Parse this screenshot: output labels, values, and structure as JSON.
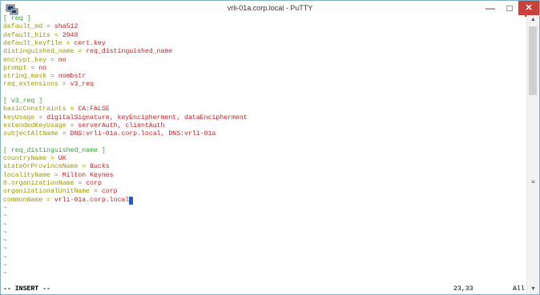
{
  "window": {
    "title": "vrli-01a.corp.local - PuTTY",
    "minimize_glyph": "—",
    "maximize_glyph": "□",
    "close_glyph": "✕"
  },
  "icons": {
    "app": "putty-app-icon",
    "scroll_up": "scroll-up-arrow-icon",
    "scroll_down": "scroll-down-arrow-icon",
    "scroll_grip": "scroll-grip-icon"
  },
  "colors": {
    "key_text": "#9a9a00",
    "value_text": "#cc1f1f",
    "section_text": "#2fa82f",
    "tilde_text": "#3b63d8",
    "cursor": "#1e5bd8",
    "close_button": "#c8403b"
  },
  "editor": {
    "lines": [
      {
        "key": "[ req ]",
        "val": "",
        "type": "section"
      },
      {
        "key": "default_md",
        "val": "sha512",
        "type": "kv"
      },
      {
        "key": "default_bits",
        "val": "2048",
        "type": "kv"
      },
      {
        "key": "default_keyfile",
        "val": "cert.key",
        "type": "kv"
      },
      {
        "key": "distinguished_name",
        "val": "req_distinguished_name",
        "type": "kv"
      },
      {
        "key": "encrypt_key",
        "val": "no",
        "type": "kv"
      },
      {
        "key": "prompt",
        "val": "no",
        "type": "kv"
      },
      {
        "key": "string_mask",
        "val": "nombstr",
        "type": "kv"
      },
      {
        "key": "req_extensions",
        "val": "v3_req",
        "type": "kv"
      },
      {
        "key": "",
        "val": "",
        "type": "blank"
      },
      {
        "key": "[ v3_req ]",
        "val": "",
        "type": "section"
      },
      {
        "key": "basicConstraints",
        "val": "CA:FALSE",
        "type": "kv"
      },
      {
        "key": "keyUsage",
        "val": "digitalSignature, keyEncipherment, dataEncipherment",
        "type": "kv"
      },
      {
        "key": "extendedKeyUsage",
        "val": "serverAuth, clientAuth",
        "type": "kv"
      },
      {
        "key": "subjectAltName",
        "val": "DNS:vrli-01a.corp.local, DNS:vrli-01a",
        "type": "kv"
      },
      {
        "key": "",
        "val": "",
        "type": "blank"
      },
      {
        "key": "[ req_distinguished_name ]",
        "val": "",
        "type": "section"
      },
      {
        "key": "countryName",
        "val": "UK",
        "type": "kv"
      },
      {
        "key": "stateOrProvinceName",
        "val": "Bucks",
        "type": "kv"
      },
      {
        "key": "localityName",
        "val": "Milton Keynes",
        "type": "kv"
      },
      {
        "key": "0.organizationName",
        "val": "corp",
        "type": "kv"
      },
      {
        "key": "organizationalUnitName",
        "val": "corp",
        "type": "kv"
      },
      {
        "key": "commonName",
        "val": "vrli-01a.corp.local",
        "type": "kv_cursor"
      }
    ],
    "separator": " = ",
    "tilde_char": "~",
    "tilde_count": 9
  },
  "status": {
    "mode": "-- INSERT --",
    "position": "23,33",
    "percent": "All"
  }
}
